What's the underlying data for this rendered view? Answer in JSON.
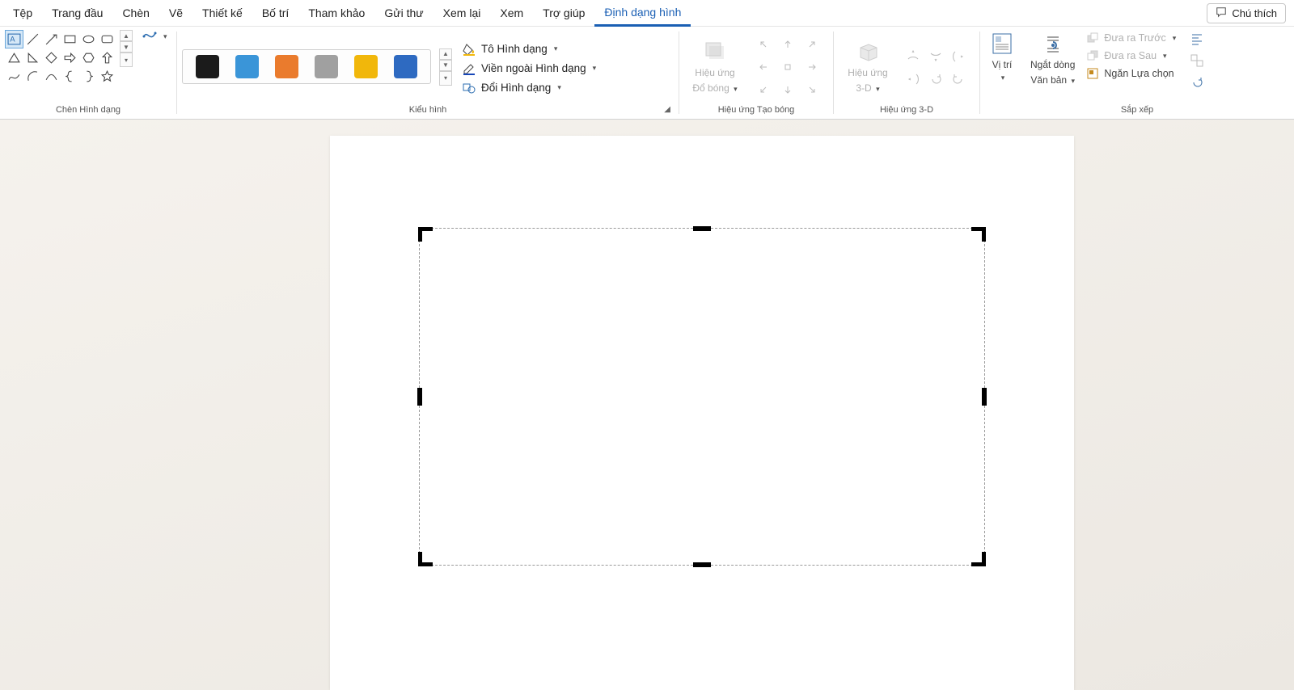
{
  "menu": {
    "items": [
      "Tệp",
      "Trang đầu",
      "Chèn",
      "Vẽ",
      "Thiết kế",
      "Bố trí",
      "Tham khảo",
      "Gửi thư",
      "Xem lại",
      "Xem",
      "Trợ giúp",
      "Định dạng hình"
    ],
    "active_index": 11,
    "comment_label": "Chú thích"
  },
  "ribbon": {
    "groups": {
      "insert_shape": "Chèn Hình dạng",
      "shape_styles": "Kiểu hình",
      "shadow": "Hiệu ứng Tạo bóng",
      "threeD": "Hiệu ứng 3-D",
      "arrange": "Sắp xếp"
    },
    "fill_menu": {
      "fill": "Tô Hình dạng",
      "outline": "Viền ngoài Hình dạng",
      "change": "Đổi Hình dạng"
    },
    "shadow_btn": {
      "line1": "Hiệu ứng",
      "line2": "Đổ bóng"
    },
    "threeD_btn": {
      "line1": "Hiệu ứng",
      "line2": "3-D"
    },
    "position": "Vị trí",
    "wrap": {
      "line1": "Ngắt dòng",
      "line2": "Văn bản"
    },
    "bring_front": "Đưa ra Trước",
    "send_back": "Đưa ra Sau",
    "selection_pane": "Ngăn Lựa chọn",
    "swatches": [
      "#1b1b1b",
      "#3a95d8",
      "#ea7b2d",
      "#a0a0a0",
      "#f1b70b",
      "#2e6ac1"
    ]
  }
}
